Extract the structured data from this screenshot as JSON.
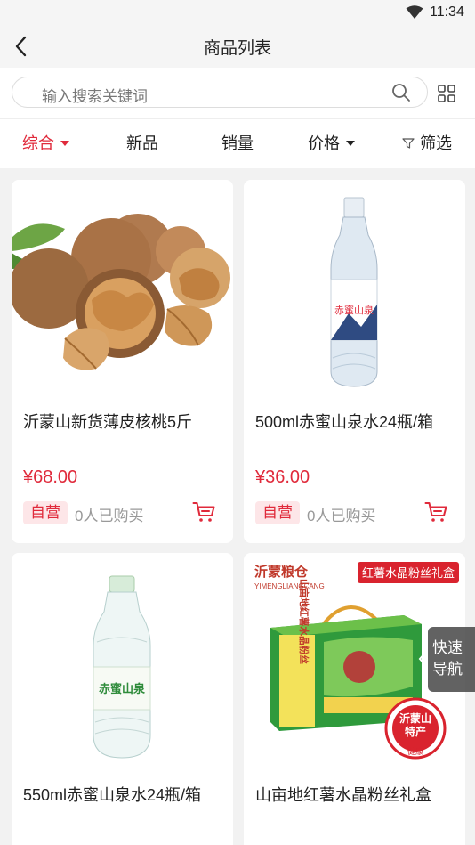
{
  "status_bar": {
    "time": "11:34"
  },
  "header": {
    "title": "商品列表"
  },
  "search": {
    "placeholder": "输入搜索关键词"
  },
  "sort_tabs": [
    {
      "label": "综合",
      "active": true
    },
    {
      "label": "新品"
    },
    {
      "label": "销量"
    },
    {
      "label": "价格"
    },
    {
      "label": "筛选"
    }
  ],
  "products": [
    {
      "name": "沂蒙山新货薄皮核桃5斤",
      "price": "¥68.00",
      "badge": "自营",
      "sold": "0人已购买"
    },
    {
      "name": "500ml赤蜜山泉水24瓶/箱",
      "price": "¥36.00",
      "badge": "自营",
      "sold": "0人已购买"
    },
    {
      "name": "550ml赤蜜山泉水24瓶/箱",
      "price": "",
      "badge": "",
      "sold": ""
    },
    {
      "name": "山亩地红薯水晶粉丝礼盒",
      "price": "",
      "badge": "",
      "sold": ""
    }
  ],
  "product_images": {
    "bottle_label": "赤蜜山泉",
    "gift_brand": "沂蒙粮仓",
    "gift_brand_pinyin": "YIMENGLIANGCANG",
    "gift_tag": "红薯水晶粉丝礼盒",
    "gift_box_text": "山亩地红薯水晶粉丝",
    "gift_seal_line1": "沂蒙山",
    "gift_seal_line2": "特产",
    "gift_seal_line3": "健康"
  },
  "quick_nav": {
    "line1": "快速",
    "line2": "导航"
  },
  "colors": {
    "accent": "#e02a3b",
    "badge_bg": "#fde6e8",
    "page_bg": "#f2f2f2"
  }
}
